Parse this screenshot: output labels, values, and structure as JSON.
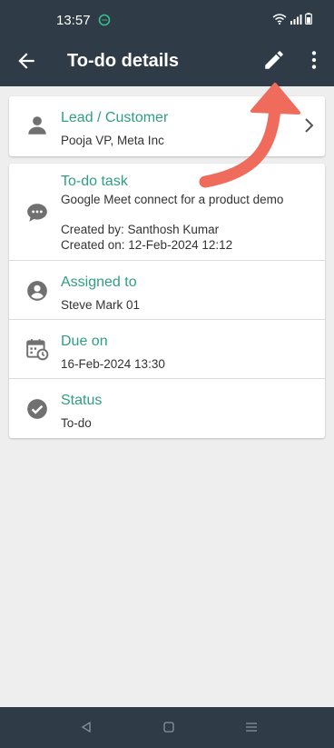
{
  "status_bar": {
    "time": "13:57"
  },
  "app_bar": {
    "title": "To-do details"
  },
  "lead": {
    "label": "Lead / Customer",
    "value": "Pooja VP, Meta Inc"
  },
  "task": {
    "label": "To-do task",
    "description": "Google Meet connect for a product demo",
    "created_by": "Created by: Santhosh Kumar",
    "created_on": "Created on: 12-Feb-2024 12:12"
  },
  "assigned": {
    "label": "Assigned to",
    "value": "Steve Mark 01"
  },
  "due": {
    "label": "Due on",
    "value": "16-Feb-2024 13:30"
  },
  "status": {
    "label": "Status",
    "value": "To-do"
  },
  "colors": {
    "app_bar": "#2f3b47",
    "accent_label": "#2f9e82",
    "annotation_arrow": "#ef6c5d",
    "icon_gray": "#707070"
  },
  "icons": {
    "back": "arrow-left-icon",
    "edit": "pencil-icon",
    "more": "more-vertical-icon",
    "lead": "person-icon",
    "task": "chat-bubble-icon",
    "assigned": "account-circle-icon",
    "due": "calendar-clock-icon",
    "status": "check-circle-icon"
  }
}
